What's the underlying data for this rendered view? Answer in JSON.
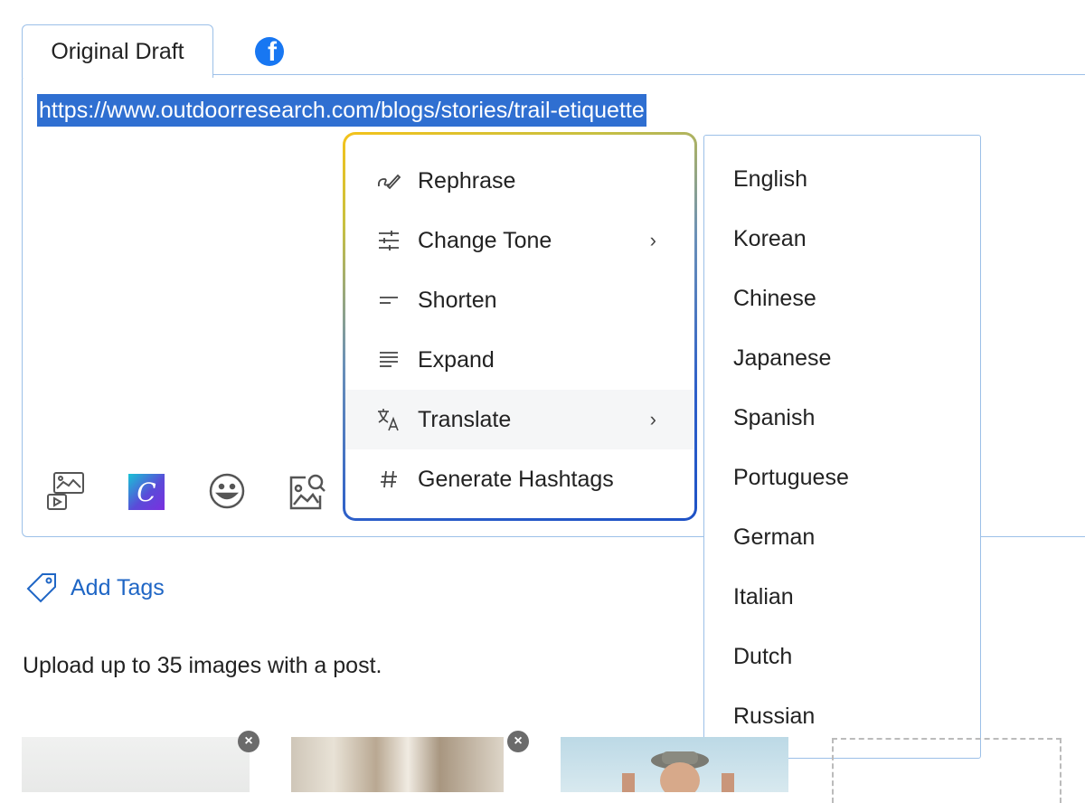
{
  "tabs": {
    "original_draft": "Original Draft",
    "facebook_icon": "facebook-icon"
  },
  "editor": {
    "selected_text": "https://www.outdoorresearch.com/blogs/stories/trail-etiquette"
  },
  "toolbar": {
    "icons": [
      "media-gallery-icon",
      "canva-icon",
      "emoji-icon",
      "image-search-icon"
    ],
    "canva_letter": "C"
  },
  "ai_menu": {
    "items": [
      {
        "label": "Rephrase",
        "icon": "pen-swirl-icon",
        "has_submenu": false
      },
      {
        "label": "Change Tone",
        "icon": "sliders-icon",
        "has_submenu": true
      },
      {
        "label": "Shorten",
        "icon": "short-lines-icon",
        "has_submenu": false
      },
      {
        "label": "Expand",
        "icon": "long-lines-icon",
        "has_submenu": false
      },
      {
        "label": "Translate",
        "icon": "translate-icon",
        "has_submenu": true,
        "highlighted": true
      },
      {
        "label": "Generate Hashtags",
        "icon": "hashtag-icon",
        "has_submenu": false
      }
    ],
    "chevron": "›"
  },
  "translate_submenu": {
    "languages": [
      "English",
      "Korean",
      "Chinese",
      "Japanese",
      "Spanish",
      "Portuguese",
      "German",
      "Italian",
      "Dutch",
      "Russian"
    ]
  },
  "tags": {
    "add_label": "Add Tags"
  },
  "upload": {
    "hint": "Upload up to 35 images with a post."
  },
  "thumbnails": {
    "remove_symbol": "×"
  },
  "colors": {
    "accent": "#1f66c5",
    "selection": "#2f6fd1",
    "border": "#9cc0e8",
    "facebook": "#1877f2"
  }
}
